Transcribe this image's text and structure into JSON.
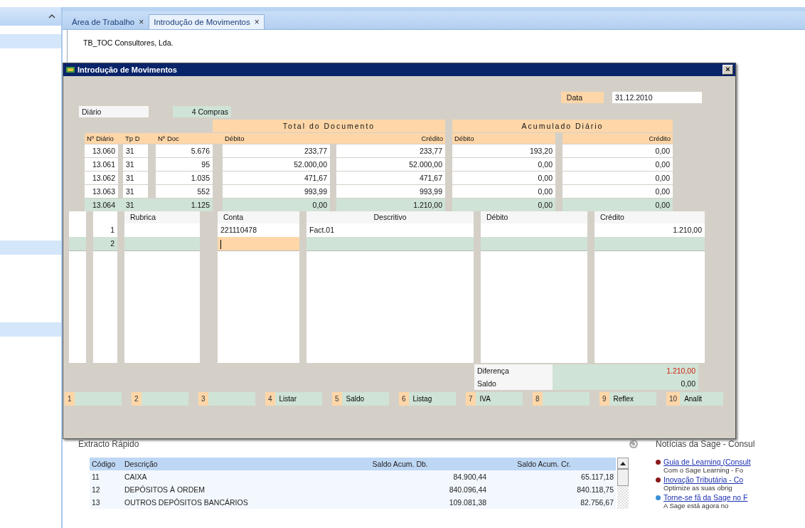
{
  "tabs": [
    {
      "label": "Área de Trabalho",
      "close": "×",
      "selected": false
    },
    {
      "label": "Introdução de Movimentos",
      "close": "×",
      "selected": true
    }
  ],
  "company": "TB_TOC Consultores, Lda.",
  "dialog": {
    "title": "Introdução de Movimentos",
    "close": "×",
    "date_label": "Data",
    "date": "31.12.2010",
    "journal": "Diário",
    "journal_type": "4 Compras",
    "documents": {
      "groups": [
        "Total do Documento",
        "Acumulado Diário"
      ],
      "columns": [
        "Nº Diário",
        "Tp D",
        "Nº Doc",
        "Débito",
        "Crédito",
        "Débito",
        "Crédito"
      ],
      "rows": [
        {
          "cells": [
            "13.060",
            "31",
            "5.676",
            "233,77",
            "233,77",
            "193,20",
            "0,00"
          ],
          "selected": false
        },
        {
          "cells": [
            "13.061",
            "31",
            "95",
            "52.000,00",
            "52.000,00",
            "0,00",
            "0,00"
          ],
          "selected": false
        },
        {
          "cells": [
            "13.062",
            "31",
            "1.035",
            "471,67",
            "471,67",
            "0,00",
            "0,00"
          ],
          "selected": false
        },
        {
          "cells": [
            "13.063",
            "31",
            "552",
            "993,99",
            "993,99",
            "0,00",
            "0,00"
          ],
          "selected": false
        },
        {
          "cells": [
            "13.064",
            "31",
            "1.125",
            "0,00",
            "1.210,00",
            "0,00",
            "0,00"
          ],
          "selected": true
        }
      ]
    },
    "lines": {
      "columns": [
        "Rubrica",
        "Conta",
        "Descritivo",
        "Débito",
        "Crédito"
      ],
      "rows": [
        {
          "number": "1",
          "account": "221110478",
          "description": "Fact.01",
          "credit": "1.210,00",
          "selected": false,
          "editing": false
        },
        {
          "number": "2",
          "selected": true,
          "editing": true
        }
      ]
    },
    "totals": [
      {
        "label": "Diferença",
        "value": "1.210,00",
        "alert": true
      },
      {
        "label": "Saldo",
        "value": "0,00",
        "alert": false
      }
    ],
    "function_keys": [
      {
        "key": "1"
      },
      {
        "key": "2"
      },
      {
        "key": "3"
      },
      {
        "key": "4",
        "label": "Listar"
      },
      {
        "key": "5",
        "label": "Saldo"
      },
      {
        "key": "6",
        "label": "Listag"
      },
      {
        "key": "7",
        "label": "IVA"
      },
      {
        "key": "8"
      },
      {
        "key": "9",
        "label": "Reflex"
      },
      {
        "key": "10",
        "label": "Analit"
      }
    ]
  },
  "extract": {
    "title": "Extracto Rápido",
    "columns": [
      "Código",
      "Descrição",
      "Saldo Acum. Db.",
      "Saldo Acum. Cr."
    ],
    "rows": [
      {
        "cells": [
          "11",
          "CAIXA",
          "84.900,44",
          "65.117,18"
        ]
      },
      {
        "cells": [
          "12",
          "DEPÓSITOS À ORDEM",
          "840.096,44",
          "840.118,75"
        ]
      },
      {
        "cells": [
          "13",
          "OUTROS DEPÓSITOS BANCÁRIOS",
          "109.081,38",
          "82.756,67"
        ]
      }
    ]
  },
  "news": {
    "title": "Notícias da Sage - Consul",
    "items": [
      {
        "title": "Guia de Learning (Consult",
        "text": "Com o Sage Learning - Fo",
        "color": "#8b1a1a"
      },
      {
        "title": "Inovação Tributária - Co",
        "text": "Optimize as suas obrig",
        "color": "#8b1a1a"
      },
      {
        "title": "Torne-se fã da Sage no F",
        "text": "A Sage está agora no",
        "color": "#3a8fd8"
      }
    ]
  }
}
